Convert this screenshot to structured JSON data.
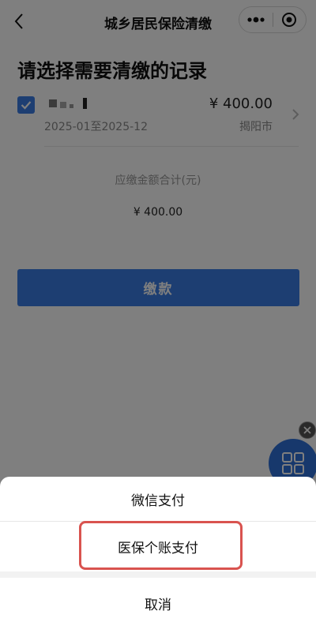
{
  "nav": {
    "title": "城乡居民保险清缴",
    "back_icon": "chevron-left-icon",
    "more_icon": "more-dots-icon",
    "close_icon": "target-circle-icon"
  },
  "heading": "请选择需要清缴的记录",
  "record": {
    "checked": true,
    "period": "2025-01至2025-12",
    "amount": "¥ 400.00",
    "city": "揭阳市"
  },
  "summary": {
    "label": "应缴金额合计(元)",
    "amount": "¥ 400.00"
  },
  "pay_button": "缴款",
  "action_sheet": {
    "wechat_pay": "微信支付",
    "medical_account_pay": "医保个账支付",
    "cancel": "取消"
  },
  "colors": {
    "accent": "#3b7ce4",
    "highlight": "#d9534f"
  }
}
